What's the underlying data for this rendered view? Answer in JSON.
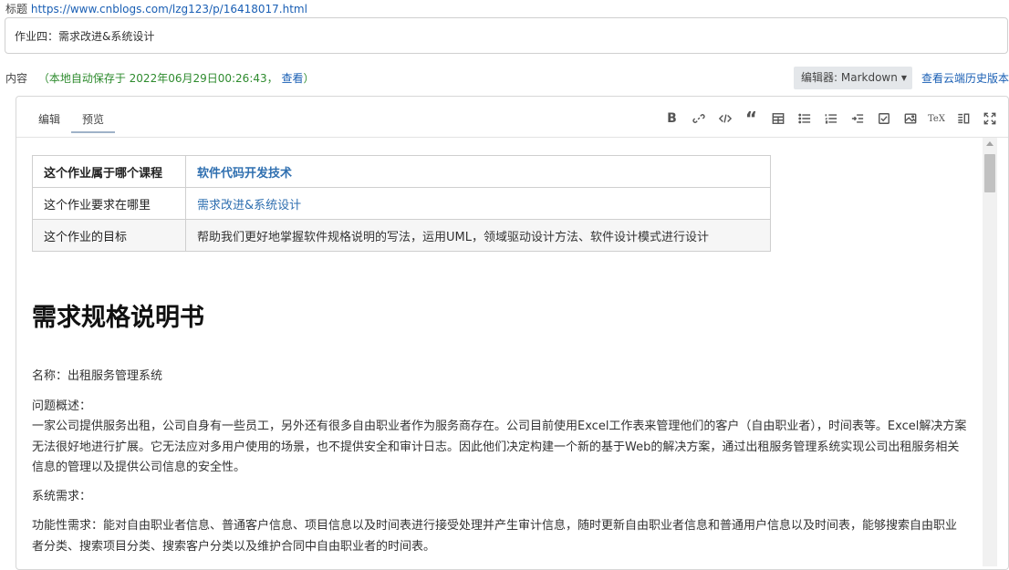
{
  "title_field": {
    "label": "标题",
    "url": "https://www.cnblogs.com/lzg123/p/16418017.html",
    "value": "作业四：需求改进&系统设计"
  },
  "content_field": {
    "label": "内容",
    "autosave_text": "（本地自动保存于 2022年06月29日00:26:43，",
    "view_link": "查看",
    "close_paren": "）",
    "editor_select": "编辑器: Markdown",
    "history_link": "查看云端历史版本"
  },
  "tabs": [
    "编辑",
    "预览"
  ],
  "toolbar": [
    "bold-icon",
    "link-icon",
    "code-icon",
    "quote-icon",
    "table-icon",
    "bullet-list-icon",
    "numbered-list-icon",
    "indent-icon",
    "checkbox-icon",
    "image-icon",
    "tex-icon",
    "side-by-side-icon",
    "fullscreen-icon"
  ],
  "toolbar_labels": {
    "bold": "B",
    "quote": "“",
    "tex": "TeX"
  },
  "preview": {
    "table": [
      {
        "key": "这个作业属于哪个课程",
        "value": "软件代码开发技术"
      },
      {
        "key": "这个作业要求在哪里",
        "value": "需求改进&系统设计"
      },
      {
        "key": "这个作业的目标",
        "value": " 帮助我们更好地掌握软件规格说明的写法，运用UML，领域驱动设计方法、软件设计模式进行设计"
      }
    ],
    "heading": "需求规格说明书",
    "name_line": " 名称：出租服务管理系统",
    "problem_label": "问题概述：",
    "problem_text": "一家公司提供服务出租，公司自身有一些员工，另外还有很多自由职业者作为服务商存在。公司目前使用Excel工作表来管理他们的客户（自由职业者），时间表等。Excel解决方案无法很好地进行扩展。它无法应对多用户使用的场景，也不提供安全和审计日志。因此他们决定构建一个新的基于Web的解决方案，通过出租服务管理系统实现公司出租服务相关信息的管理以及提供公司信息的安全性。",
    "system_label": "系统需求：",
    "functional_text": " 功能性需求：能对自由职业者信息、普通客户信息、项目信息以及时间表进行接受处理并产生审计信息，随时更新自由职业者信息和普通用户信息以及时间表，能够搜索自由职业者分类、搜索项目分类、搜索客户分类以及维护合同中自由职业者的时间表。"
  }
}
